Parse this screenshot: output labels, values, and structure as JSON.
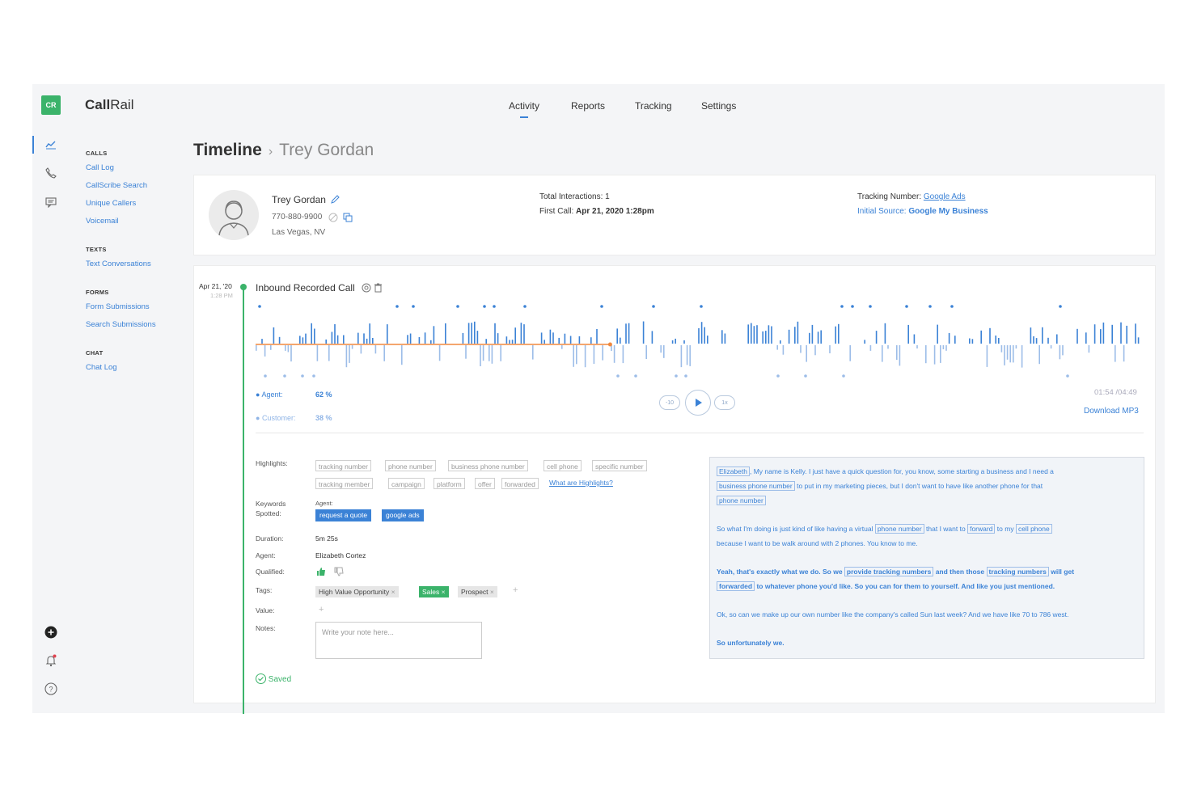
{
  "brand": {
    "logo": "CR",
    "name_bold": "Call",
    "name_rest": "Rail"
  },
  "rail_icons": [
    "analytics-icon",
    "phone-icon",
    "message-icon",
    "plus-circle-icon",
    "bell-icon",
    "help-icon"
  ],
  "sidenav": {
    "calls_head": "CALLS",
    "calls": [
      "Call Log",
      "CallScribe Search",
      "Unique Callers",
      "Voicemail"
    ],
    "texts_head": "TEXTS",
    "texts": [
      "Text Conversations"
    ],
    "forms_head": "FORMS",
    "forms": [
      "Form Submissions",
      "Search Submissions"
    ],
    "chat_head": "CHAT",
    "chat": [
      "Chat Log"
    ]
  },
  "topnav": {
    "activity": "Activity",
    "reports": "Reports",
    "tracking": "Tracking",
    "settings": "Settings"
  },
  "breadcrumb": {
    "root": "Timeline",
    "sep": "›",
    "current": "Trey Gordan"
  },
  "contact": {
    "name": "Trey Gordan",
    "phone": "770-880-9900",
    "location": "Las Vegas, NV",
    "total_label": "Total Interactions:",
    "total_value": "1",
    "first_label": "First Call:",
    "first_value": "Apr 21, 2020 1:28pm",
    "tracking_label": "Tracking Number:",
    "tracking_value": "Google Ads",
    "source_label": "Initial Source:",
    "source_value": "Google My Business"
  },
  "call": {
    "date": "Apr 21, '20",
    "time": "1:28 PM",
    "title": "Inbound Recorded Call",
    "agent_label": "Agent:",
    "agent_pct": "62 %",
    "customer_label": "Customer:",
    "customer_pct": "38 %",
    "time_display": "01:54 /04:49",
    "download": "Download MP3",
    "rewind": "-10",
    "speed": "1x",
    "progress": 0.4
  },
  "details": {
    "highlights_label": "Highlights:",
    "highlights_row1": [
      "tracking number",
      "phone number",
      "business phone number",
      "cell phone",
      "specific number"
    ],
    "highlights_row2": [
      "tracking member",
      "campaign",
      "platform",
      "offer",
      "forwarded"
    ],
    "highlights_help": "What are Highlights?",
    "keywords_label_1": "Keywords",
    "keywords_label_2": "Spotted:",
    "keywords_sub": "Agent:",
    "keywords": [
      "request a quote",
      "google ads"
    ],
    "duration_label": "Duration:",
    "duration": "5m 25s",
    "agent_label": "Agent:",
    "agent": "Elizabeth Cortez",
    "qualified_label": "Qualified:",
    "tags_label": "Tags:",
    "tags": [
      "High Value Opportunity",
      "Sales",
      "Prospect"
    ],
    "tag_remove": "×",
    "add": "+",
    "value_label": "Value:",
    "notes_label": "Notes:",
    "notes_placeholder": "Write your note here...",
    "saved": "Saved"
  },
  "transcript": {
    "l1_hl": "Elizabeth",
    "l1_a": ", My name is Kelly. I just have a quick question for, you know, some starting a business and I need a",
    "l2_hl": "business phone number",
    "l2_a": "to put in my marketing pieces, but I don't want to have like another phone for that",
    "l3_hl": "phone number",
    "l4_a": "So what I'm doing is just kind of like having a virtual",
    "l4_hl1": "phone number",
    "l4_b": "that I want to",
    "l4_hl2": "forward",
    "l4_c": "to my",
    "l4_hl3": "cell phone",
    "l5_a": "because I want to be walk around with 2 phones. You know to me.",
    "l6_a": "Yeah, that's exactly what we do. So we",
    "l6_hl1": "provide tracking numbers",
    "l6_b": "and then those",
    "l6_hl2": "tracking numbers",
    "l6_c": "will get",
    "l7_hl": "forwarded",
    "l7_a": "to whatever phone you'd like. So you can for them to yourself. And like you just mentioned.",
    "l8_a": "Ok, so can we make up our own number like the company's called Sun last week? And we have like 70 to 786 west.",
    "l9_a": "So unfortunately we."
  },
  "colors": {
    "accent": "#3b82d6",
    "green": "#3bb36a",
    "progress": "#f0883e"
  }
}
